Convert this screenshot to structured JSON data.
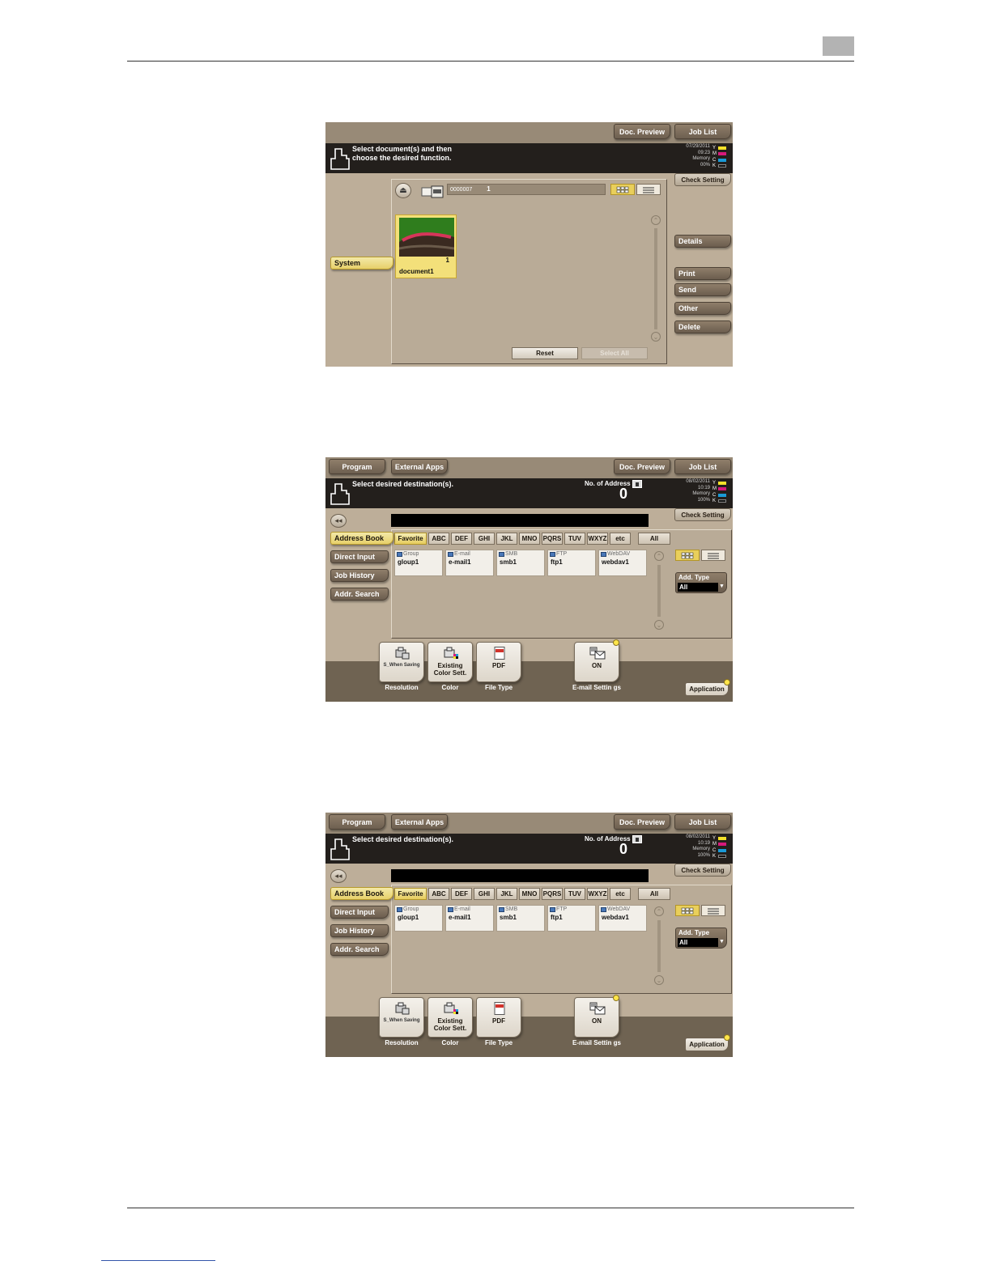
{
  "panel1": {
    "topbar": {
      "doc_preview": "Doc. Preview",
      "job_list": "Job List"
    },
    "message": "Select document(s) and then\nchoose the desired function.",
    "status": {
      "date": "07/29/2011",
      "time": "09:23",
      "memory_label": "Memory",
      "memory_value": "00%"
    },
    "toner": [
      {
        "letter": "Y",
        "color": "#f4e12a"
      },
      {
        "letter": "M",
        "color": "#d6197a"
      },
      {
        "letter": "C",
        "color": "#1a9ad6"
      },
      {
        "letter": "K",
        "color": "#111111"
      }
    ],
    "check_setting": "Check Setting",
    "box_id": "0000007",
    "box_count": "1",
    "left_tab": "System",
    "document": {
      "name": "document1",
      "pages": "1"
    },
    "side_buttons": {
      "details": "Details",
      "print": "Print",
      "send": "Send",
      "other": "Other",
      "delete": "Delete"
    },
    "reset": "Reset",
    "select_all": "Select All"
  },
  "panels": [
    {
      "program": "Program",
      "external_apps": "External Apps",
      "doc_preview": "Doc. Preview",
      "job_list": "Job List",
      "message": "Select desired destination(s).",
      "addr_label": "No. of Address",
      "addr_value": "0",
      "status": {
        "date": "08/02/2011",
        "time": "10:19",
        "memory_label": "Memory",
        "memory_value": "100%"
      },
      "check_setting": "Check Setting",
      "left_tabs": [
        "Address Book",
        "Direct Input",
        "Job History",
        "Addr. Search"
      ],
      "alpha_tabs": [
        "Favorite",
        "ABC",
        "DEF",
        "GHI",
        "JKL",
        "MNO",
        "PQRS",
        "TUV",
        "WXYZ",
        "etc",
        "All"
      ],
      "destinations": [
        {
          "type": "Group",
          "name": "gloup1"
        },
        {
          "type": "E-mail",
          "name": "e-mail1"
        },
        {
          "type": "SMB",
          "name": "smb1"
        },
        {
          "type": "FTP",
          "name": "ftp1"
        },
        {
          "type": "WebDAV",
          "name": "webdav1"
        }
      ],
      "add_type_label": "Add. Type",
      "add_type_value": "All",
      "functions": [
        {
          "text": "S_When Saving",
          "label": "Resolution"
        },
        {
          "text": "Existing Color Sett.",
          "label": "Color"
        },
        {
          "text": "PDF",
          "label": "File Type"
        },
        {
          "text": "ON",
          "label": "E-mail Settin gs"
        }
      ],
      "application": "Application"
    },
    {
      "program": "Program",
      "external_apps": "External Apps",
      "doc_preview": "Doc. Preview",
      "job_list": "Job List",
      "message": "Select desired destination(s).",
      "addr_label": "No. of Address",
      "addr_value": "0",
      "status": {
        "date": "08/02/2011",
        "time": "10:19",
        "memory_label": "Memory",
        "memory_value": "100%"
      },
      "check_setting": "Check Setting",
      "left_tabs": [
        "Address Book",
        "Direct Input",
        "Job History",
        "Addr. Search"
      ],
      "alpha_tabs": [
        "Favorite",
        "ABC",
        "DEF",
        "GHI",
        "JKL",
        "MNO",
        "PQRS",
        "TUV",
        "WXYZ",
        "etc",
        "All"
      ],
      "destinations": [
        {
          "type": "Group",
          "name": "gloup1"
        },
        {
          "type": "E-mail",
          "name": "e-mail1"
        },
        {
          "type": "SMB",
          "name": "smb1"
        },
        {
          "type": "FTP",
          "name": "ftp1"
        },
        {
          "type": "WebDAV",
          "name": "webdav1"
        }
      ],
      "add_type_label": "Add. Type",
      "add_type_value": "All",
      "functions": [
        {
          "text": "S_When Saving",
          "label": "Resolution"
        },
        {
          "text": "Existing Color Sett.",
          "label": "Color"
        },
        {
          "text": "PDF",
          "label": "File Type"
        },
        {
          "text": "ON",
          "label": "E-mail Settin gs"
        }
      ],
      "application": "Application"
    }
  ]
}
